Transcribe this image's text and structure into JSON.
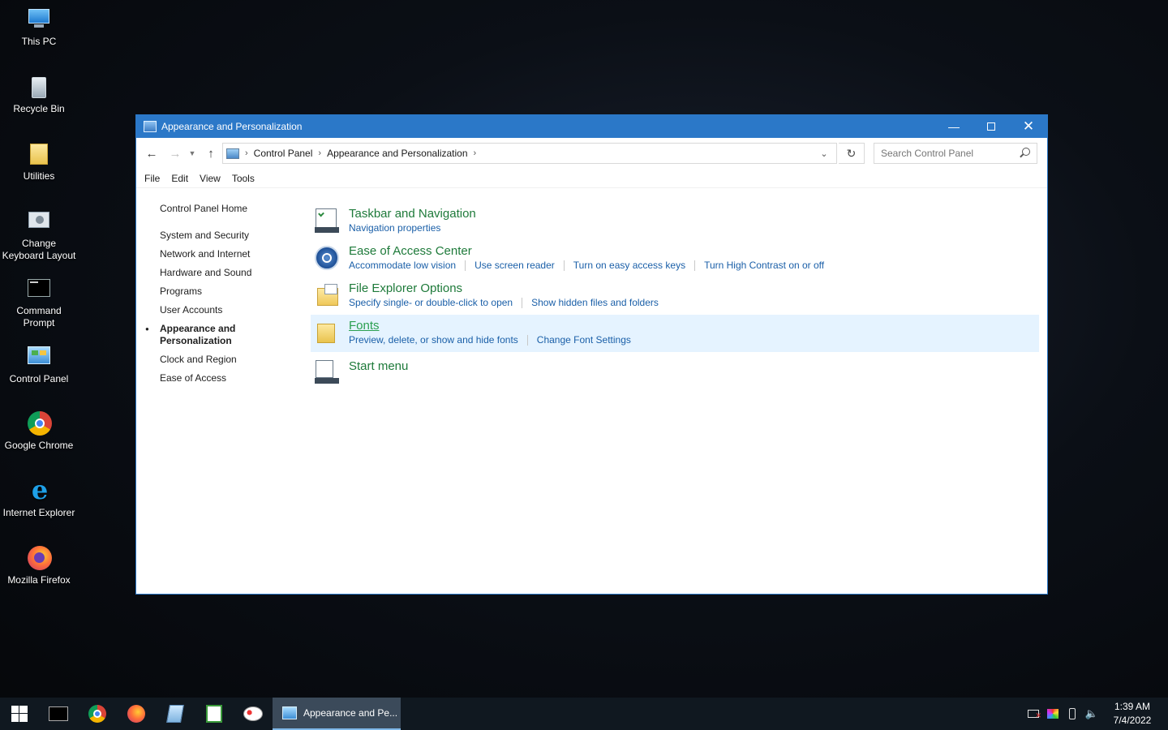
{
  "desktop": {
    "icons": [
      {
        "label": "This PC",
        "icon": "this-pc-icon"
      },
      {
        "label": "Recycle Bin",
        "icon": "recycle-bin-icon"
      },
      {
        "label": "Utilities",
        "icon": "folder-icon"
      },
      {
        "label": "Change Keyboard Layout",
        "icon": "keyboard-settings-icon"
      },
      {
        "label": "Command Prompt",
        "icon": "command-prompt-icon"
      },
      {
        "label": "Control Panel",
        "icon": "control-panel-icon"
      },
      {
        "label": "Google Chrome",
        "icon": "chrome-icon"
      },
      {
        "label": "Internet Explorer",
        "icon": "internet-explorer-icon"
      },
      {
        "label": "Mozilla Firefox",
        "icon": "firefox-icon"
      }
    ]
  },
  "window": {
    "title": "Appearance and Personalization",
    "accent": "#2b78c8",
    "breadcrumb": [
      "Control Panel",
      "Appearance and Personalization"
    ],
    "search_placeholder": "Search Control Panel",
    "menu": [
      "File",
      "Edit",
      "View",
      "Tools"
    ]
  },
  "sidebar": {
    "home": "Control Panel Home",
    "items": [
      "System and Security",
      "Network and Internet",
      "Hardware and Sound",
      "Programs",
      "User Accounts",
      "Appearance and Personalization",
      "Clock and Region",
      "Ease of Access"
    ],
    "active": "Appearance and Personalization"
  },
  "categories": [
    {
      "title": "Taskbar and Navigation",
      "icon": "taskbar-icon",
      "links": [
        "Navigation properties"
      ]
    },
    {
      "title": "Ease of Access Center",
      "icon": "ease-of-access-icon",
      "links": [
        "Accommodate low vision",
        "Use screen reader",
        "Turn on easy access keys",
        "Turn High Contrast on or off"
      ]
    },
    {
      "title": "File Explorer Options",
      "icon": "folder-options-icon",
      "links": [
        "Specify single- or double-click to open",
        "Show hidden files and folders"
      ]
    },
    {
      "title": "Fonts",
      "icon": "fonts-folder-icon",
      "links": [
        "Preview, delete, or show and hide fonts",
        "Change Font Settings"
      ],
      "hovered": true
    },
    {
      "title": "Start menu",
      "icon": "start-menu-icon",
      "links": []
    }
  ],
  "taskbar": {
    "active_window": "Appearance and Pe...",
    "time": "1:39 AM",
    "date": "7/4/2022"
  }
}
